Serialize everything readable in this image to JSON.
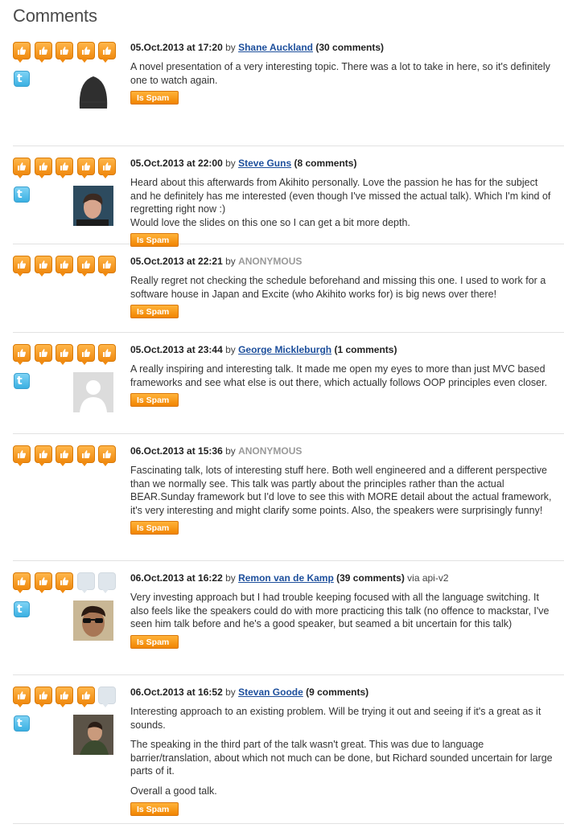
{
  "title": "Comments",
  "spam_label": "Is Spam",
  "by_label": "by",
  "comments": [
    {
      "date": "05.Oct.2013 at 17:20",
      "author": "Shane Auckland",
      "count": "(30 comments)",
      "anonymous": false,
      "twitter": true,
      "avatar": "beanie",
      "rating": 5,
      "paragraphs": [
        "A novel presentation of a very interesting topic. There was a lot to take in here, so it's definitely one to watch again."
      ]
    },
    {
      "date": "05.Oct.2013 at 22:00",
      "author": "Steve Guns",
      "count": "(8 comments)",
      "anonymous": false,
      "twitter": true,
      "avatar": "person",
      "rating": 5,
      "paragraphs": [
        "Heard about this afterwards from Akihito personally. Love the passion he has for the subject and he definitely has me interested (even though I've missed the actual talk). Which I'm kind of regretting right now :)",
        "Would love the slides on this one so I can get a bit more depth."
      ]
    },
    {
      "date": "05.Oct.2013 at 22:21",
      "author": "ANONYMOUS",
      "count": "",
      "anonymous": true,
      "twitter": false,
      "avatar": "",
      "rating": 5,
      "paragraphs": [
        "Really regret not checking the schedule beforehand and missing this one. I used to work for a software house in Japan and Excite (who Akihito works for) is big news over there!"
      ]
    },
    {
      "date": "05.Oct.2013 at 23:44",
      "author": "George Mickleburgh",
      "count": "(1 comments)",
      "anonymous": false,
      "twitter": true,
      "avatar": "default",
      "rating": 5,
      "paragraphs": [
        "A really inspiring and interesting talk. It made me open my eyes to more than just MVC based frameworks and see what else is out there, which actually follows OOP principles even closer."
      ]
    },
    {
      "date": "06.Oct.2013 at 15:36",
      "author": "ANONYMOUS",
      "count": "",
      "anonymous": true,
      "twitter": false,
      "avatar": "",
      "rating": 5,
      "paragraphs": [
        "Fascinating talk, lots of interesting stuff here. Both well engineered and a different perspective than we normally see. This talk was partly about the principles rather than the actual BEAR.Sunday framework but I'd love to see this with MORE detail about the actual framework, it's very interesting and might clarify some points. Also, the speakers were surprisingly funny!"
      ]
    },
    {
      "date": "06.Oct.2013 at 16:22",
      "author": "Remon van de Kamp",
      "count": "(39 comments)",
      "via": "via api-v2",
      "anonymous": false,
      "twitter": true,
      "avatar": "sunglasses",
      "rating": 3,
      "paragraphs": [
        "Very investing approach but I had trouble keeping focused with all the language switching. It also feels like the speakers could do with more practicing this talk (no offence to mackstar, I've seen him talk before and he's a good speaker, but seamed a bit uncertain for this talk)"
      ]
    },
    {
      "date": "06.Oct.2013 at 16:52",
      "author": "Stevan Goode",
      "count": "(9 comments)",
      "anonymous": false,
      "twitter": true,
      "avatar": "man",
      "rating": 4,
      "paragraphs": [
        "Interesting approach to an existing problem. Will be trying it out and seeing if it's a great as it sounds.",
        "The speaking in the third part of the talk wasn't great. This was due to language barrier/translation, about which not much can be done, but Richard sounded uncertain for large parts of it.",
        "Overall a good talk."
      ]
    }
  ]
}
